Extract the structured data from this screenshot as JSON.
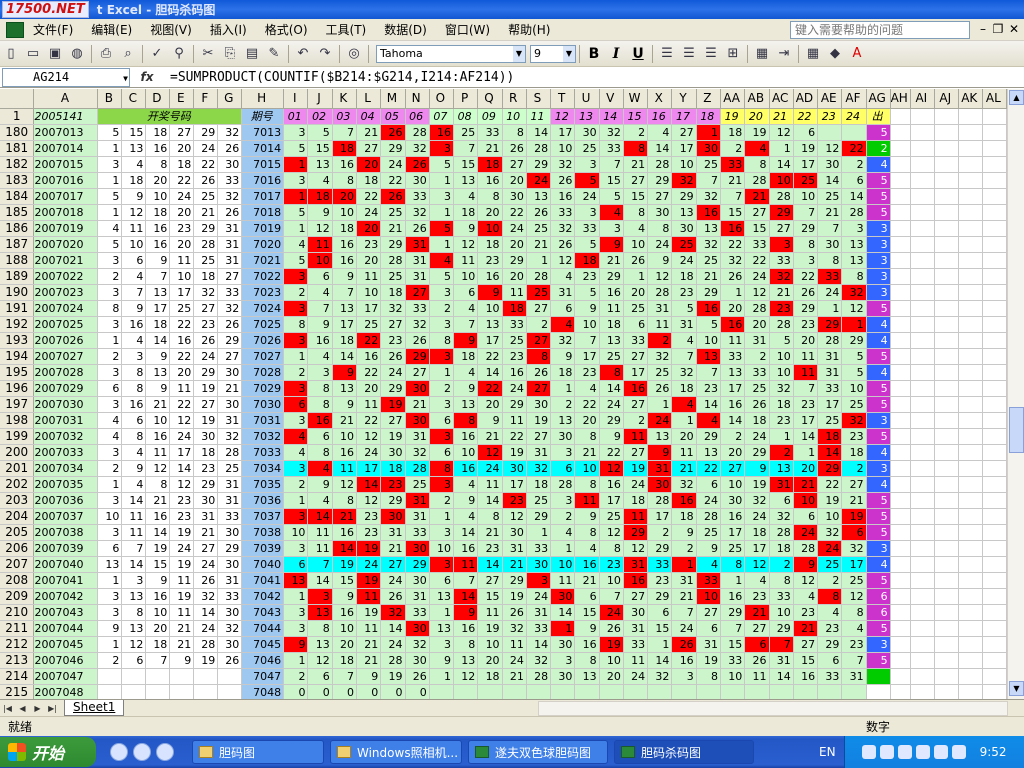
{
  "window": {
    "logo": "17500.NET",
    "title": "t Excel - 胆码杀码图"
  },
  "menu": {
    "items": [
      "文件(F)",
      "编辑(E)",
      "视图(V)",
      "插入(I)",
      "格式(O)",
      "工具(T)",
      "数据(D)",
      "窗口(W)",
      "帮助(H)"
    ],
    "help_placeholder": "键入需要帮助的问题"
  },
  "toolbar": {
    "font_name": "Tahoma",
    "font_size": "9",
    "bold": "B",
    "italic": "I",
    "underline": "U"
  },
  "formula_bar": {
    "name_box": "AG214",
    "fx": "fx",
    "formula": "=SUMPRODUCT(COUNTIF($B214:$G214,I214:AF214))"
  },
  "columns": [
    "A",
    "B",
    "C",
    "D",
    "E",
    "F",
    "G",
    "H",
    "I",
    "J",
    "K",
    "L",
    "M",
    "N",
    "O",
    "P",
    "Q",
    "R",
    "S",
    "T",
    "U",
    "V",
    "W",
    "X",
    "Y",
    "Z",
    "AA",
    "AB",
    "AC",
    "AD",
    "AE",
    "AF",
    "AG",
    "AH",
    "AI",
    "AJ",
    "AK",
    "AL"
  ],
  "row1": {
    "row_num": "1",
    "A": "2005141",
    "BG": "开奖号码",
    "H": "期号",
    "I_AF": [
      "01",
      "02",
      "03",
      "04",
      "05",
      "06",
      "07",
      "08",
      "09",
      "10",
      "11",
      "12",
      "13",
      "14",
      "15",
      "16",
      "17",
      "18",
      "19",
      "20",
      "21",
      "22",
      "23",
      "24"
    ],
    "AG": "出"
  },
  "rows": [
    {
      "r": "180",
      "a": "2007013",
      "w": [
        5,
        15,
        18,
        27,
        29,
        32
      ],
      "h": "7013",
      "m": [
        3,
        5,
        7,
        21,
        26,
        28,
        16,
        25,
        33,
        8,
        14,
        17,
        30,
        32,
        2,
        4,
        27,
        1,
        18,
        19,
        12,
        6
      ],
      "ag": "5"
    },
    {
      "r": "181",
      "a": "2007014",
      "w": [
        1,
        13,
        16,
        20,
        24,
        26
      ],
      "h": "7014",
      "m": [
        5,
        15,
        18,
        27,
        29,
        32,
        3,
        7,
        21,
        26,
        28,
        10,
        25,
        33,
        8,
        14,
        17,
        30,
        2,
        4,
        1,
        19,
        12,
        22
      ],
      "ag": "2"
    },
    {
      "r": "182",
      "a": "2007015",
      "w": [
        3,
        4,
        8,
        18,
        22,
        30
      ],
      "h": "7015",
      "m": [
        1,
        13,
        16,
        20,
        24,
        26,
        5,
        15,
        18,
        27,
        29,
        32,
        3,
        7,
        21,
        28,
        10,
        25,
        33,
        8,
        14,
        17,
        30,
        2
      ],
      "ag": "4"
    },
    {
      "r": "183",
      "a": "2007016",
      "w": [
        1,
        18,
        20,
        22,
        26,
        33
      ],
      "h": "7016",
      "m": [
        3,
        4,
        8,
        18,
        22,
        30,
        1,
        13,
        16,
        20,
        24,
        26,
        5,
        15,
        27,
        29,
        32,
        7,
        21,
        28,
        10,
        25,
        14,
        6
      ],
      "ag": "5"
    },
    {
      "r": "184",
      "a": "2007017",
      "w": [
        5,
        9,
        10,
        24,
        25,
        32
      ],
      "h": "7017",
      "m": [
        1,
        18,
        20,
        22,
        26,
        33,
        3,
        4,
        8,
        30,
        13,
        16,
        24,
        5,
        15,
        27,
        29,
        32,
        7,
        21,
        28,
        10,
        25,
        14
      ],
      "ag": "5"
    },
    {
      "r": "185",
      "a": "2007018",
      "w": [
        1,
        12,
        18,
        20,
        21,
        26
      ],
      "h": "7018",
      "m": [
        5,
        9,
        10,
        24,
        25,
        32,
        1,
        18,
        20,
        22,
        26,
        33,
        3,
        4,
        8,
        30,
        13,
        16,
        15,
        27,
        29,
        7,
        21,
        28
      ],
      "ag": "5"
    },
    {
      "r": "186",
      "a": "2007019",
      "w": [
        4,
        11,
        16,
        23,
        29,
        31
      ],
      "h": "7019",
      "m": [
        1,
        12,
        18,
        20,
        21,
        26,
        5,
        9,
        10,
        24,
        25,
        32,
        33,
        3,
        4,
        8,
        30,
        13,
        16,
        15,
        27,
        29,
        7,
        3
      ],
      "ag": "3"
    },
    {
      "r": "187",
      "a": "2007020",
      "w": [
        5,
        10,
        16,
        20,
        28,
        31
      ],
      "h": "7020",
      "m": [
        4,
        11,
        16,
        23,
        29,
        31,
        1,
        12,
        18,
        20,
        21,
        26,
        5,
        9,
        10,
        24,
        25,
        32,
        22,
        33,
        3,
        8,
        30,
        13
      ],
      "ag": "3"
    },
    {
      "r": "188",
      "a": "2007021",
      "w": [
        3,
        6,
        9,
        11,
        25,
        31
      ],
      "h": "7021",
      "m": [
        5,
        10,
        16,
        20,
        28,
        31,
        4,
        11,
        23,
        29,
        1,
        12,
        18,
        21,
        26,
        9,
        24,
        25,
        32,
        22,
        33,
        3,
        8,
        13
      ],
      "ag": "3"
    },
    {
      "r": "189",
      "a": "2007022",
      "w": [
        2,
        4,
        7,
        10,
        18,
        27
      ],
      "h": "7022",
      "m": [
        3,
        6,
        9,
        11,
        25,
        31,
        5,
        10,
        16,
        20,
        28,
        4,
        23,
        29,
        1,
        12,
        18,
        21,
        26,
        24,
        32,
        22,
        33,
        8
      ],
      "ag": "3"
    },
    {
      "r": "190",
      "a": "2007023",
      "w": [
        3,
        7,
        13,
        17,
        32,
        33
      ],
      "h": "7023",
      "m": [
        2,
        4,
        7,
        10,
        18,
        27,
        3,
        6,
        9,
        11,
        25,
        31,
        5,
        16,
        20,
        28,
        23,
        29,
        1,
        12,
        21,
        26,
        24,
        32
      ],
      "ag": "3"
    },
    {
      "r": "191",
      "a": "2007024",
      "w": [
        8,
        9,
        17,
        25,
        27,
        32
      ],
      "h": "7024",
      "m": [
        3,
        7,
        13,
        17,
        32,
        33,
        2,
        4,
        10,
        18,
        27,
        6,
        9,
        11,
        25,
        31,
        5,
        16,
        20,
        28,
        23,
        29,
        1,
        12
      ],
      "ag": "5"
    },
    {
      "r": "192",
      "a": "2007025",
      "w": [
        3,
        16,
        18,
        22,
        23,
        26
      ],
      "h": "7025",
      "m": [
        8,
        9,
        17,
        25,
        27,
        32,
        3,
        7,
        13,
        33,
        2,
        4,
        10,
        18,
        6,
        11,
        31,
        5,
        16,
        20,
        28,
        23,
        29,
        1
      ],
      "ag": "4"
    },
    {
      "r": "193",
      "a": "2007026",
      "w": [
        1,
        4,
        14,
        16,
        26,
        29
      ],
      "h": "7026",
      "m": [
        3,
        16,
        18,
        22,
        23,
        26,
        8,
        9,
        17,
        25,
        27,
        32,
        7,
        13,
        33,
        2,
        4,
        10,
        11,
        31,
        5,
        20,
        28,
        29
      ],
      "ag": "4"
    },
    {
      "r": "194",
      "a": "2007027",
      "w": [
        2,
        3,
        9,
        22,
        24,
        27
      ],
      "h": "7027",
      "m": [
        1,
        4,
        14,
        16,
        26,
        29,
        3,
        18,
        22,
        23,
        8,
        9,
        17,
        25,
        27,
        32,
        7,
        13,
        33,
        2,
        10,
        11,
        31,
        5
      ],
      "ag": "5"
    },
    {
      "r": "195",
      "a": "2007028",
      "w": [
        3,
        8,
        13,
        20,
        29,
        30
      ],
      "h": "7028",
      "m": [
        2,
        3,
        9,
        22,
        24,
        27,
        1,
        4,
        14,
        16,
        26,
        18,
        23,
        8,
        17,
        25,
        32,
        7,
        13,
        33,
        10,
        11,
        31,
        5
      ],
      "ag": "4"
    },
    {
      "r": "196",
      "a": "2007029",
      "w": [
        6,
        8,
        9,
        11,
        19,
        21
      ],
      "h": "7029",
      "m": [
        3,
        8,
        13,
        20,
        29,
        30,
        2,
        9,
        22,
        24,
        27,
        1,
        4,
        14,
        16,
        26,
        18,
        23,
        17,
        25,
        32,
        7,
        33,
        10
      ],
      "ag": "5"
    },
    {
      "r": "197",
      "a": "2007030",
      "w": [
        3,
        16,
        21,
        22,
        27,
        30
      ],
      "h": "7030",
      "m": [
        6,
        8,
        9,
        11,
        19,
        21,
        3,
        13,
        20,
        29,
        30,
        2,
        22,
        24,
        27,
        1,
        4,
        14,
        16,
        26,
        18,
        23,
        17,
        25
      ],
      "ag": "5"
    },
    {
      "r": "198",
      "a": "2007031",
      "w": [
        4,
        6,
        10,
        12,
        19,
        31
      ],
      "h": "7031",
      "m": [
        3,
        16,
        21,
        22,
        27,
        30,
        6,
        8,
        9,
        11,
        19,
        13,
        20,
        29,
        2,
        24,
        1,
        4,
        14,
        18,
        23,
        17,
        25,
        32
      ],
      "ag": "3"
    },
    {
      "r": "199",
      "a": "2007032",
      "w": [
        4,
        8,
        16,
        24,
        30,
        32
      ],
      "h": "7032",
      "m": [
        4,
        6,
        10,
        12,
        19,
        31,
        3,
        16,
        21,
        22,
        27,
        30,
        8,
        9,
        11,
        13,
        20,
        29,
        2,
        24,
        1,
        14,
        18,
        23
      ],
      "ag": "5"
    },
    {
      "r": "200",
      "a": "2007033",
      "w": [
        3,
        4,
        11,
        17,
        18,
        28
      ],
      "h": "7033",
      "m": [
        4,
        8,
        16,
        24,
        30,
        32,
        6,
        10,
        12,
        19,
        31,
        3,
        21,
        22,
        27,
        9,
        11,
        13,
        20,
        29,
        2,
        1,
        14,
        18
      ],
      "ag": "4"
    },
    {
      "r": "201",
      "a": "2007034",
      "w": [
        2,
        9,
        12,
        14,
        23,
        25
      ],
      "h": "7034",
      "m": [
        3,
        4,
        11,
        17,
        18,
        28,
        8,
        16,
        24,
        30,
        32,
        6,
        10,
        12,
        19,
        31,
        21,
        22,
        27,
        9,
        13,
        20,
        29,
        2
      ],
      "ag": "3"
    },
    {
      "r": "202",
      "a": "2007035",
      "w": [
        1,
        4,
        8,
        12,
        29,
        31
      ],
      "h": "7035",
      "m": [
        2,
        9,
        12,
        14,
        23,
        25,
        3,
        4,
        11,
        17,
        18,
        28,
        8,
        16,
        24,
        30,
        32,
        6,
        10,
        19,
        31,
        21,
        22,
        27
      ],
      "ag": "4"
    },
    {
      "r": "203",
      "a": "2007036",
      "w": [
        3,
        14,
        21,
        23,
        30,
        31
      ],
      "h": "7036",
      "m": [
        1,
        4,
        8,
        12,
        29,
        31,
        2,
        9,
        14,
        23,
        25,
        3,
        11,
        17,
        18,
        28,
        16,
        24,
        30,
        32,
        6,
        10,
        19,
        21
      ],
      "ag": "5"
    },
    {
      "r": "204",
      "a": "2007037",
      "w": [
        10,
        11,
        16,
        23,
        31,
        33
      ],
      "h": "7037",
      "m": [
        3,
        14,
        21,
        23,
        30,
        31,
        1,
        4,
        8,
        12,
        29,
        2,
        9,
        25,
        11,
        17,
        18,
        28,
        16,
        24,
        32,
        6,
        10,
        19
      ],
      "ag": "5"
    },
    {
      "r": "205",
      "a": "2007038",
      "w": [
        3,
        11,
        14,
        19,
        21,
        30
      ],
      "h": "7038",
      "m": [
        10,
        11,
        16,
        23,
        31,
        33,
        3,
        14,
        21,
        30,
        1,
        4,
        8,
        12,
        29,
        2,
        9,
        25,
        17,
        18,
        28,
        24,
        32,
        6
      ],
      "ag": "5"
    },
    {
      "r": "206",
      "a": "2007039",
      "w": [
        6,
        7,
        19,
        24,
        27,
        29
      ],
      "h": "7039",
      "m": [
        3,
        11,
        14,
        19,
        21,
        30,
        10,
        16,
        23,
        31,
        33,
        1,
        4,
        8,
        12,
        29,
        2,
        9,
        25,
        17,
        18,
        28,
        24,
        32
      ],
      "ag": "3"
    },
    {
      "r": "207",
      "a": "2007040",
      "w": [
        13,
        14,
        15,
        19,
        24,
        30
      ],
      "h": "7040",
      "m": [
        6,
        7,
        19,
        24,
        27,
        29,
        3,
        11,
        14,
        21,
        30,
        10,
        16,
        23,
        31,
        33,
        1,
        4,
        8,
        12,
        2,
        9,
        25,
        17
      ],
      "ag": "4"
    },
    {
      "r": "208",
      "a": "2007041",
      "w": [
        1,
        3,
        9,
        11,
        26,
        31
      ],
      "h": "7041",
      "m": [
        13,
        14,
        15,
        19,
        24,
        30,
        6,
        7,
        27,
        29,
        3,
        11,
        21,
        10,
        16,
        23,
        31,
        33,
        1,
        4,
        8,
        12,
        2,
        25
      ],
      "ag": "5"
    },
    {
      "r": "209",
      "a": "2007042",
      "w": [
        3,
        13,
        16,
        19,
        32,
        33
      ],
      "h": "7042",
      "m": [
        1,
        3,
        9,
        11,
        26,
        31,
        13,
        14,
        15,
        19,
        24,
        30,
        6,
        7,
        27,
        29,
        21,
        10,
        16,
        23,
        33,
        4,
        8,
        12
      ],
      "ag": "6"
    },
    {
      "r": "210",
      "a": "2007043",
      "w": [
        3,
        8,
        10,
        11,
        14,
        30
      ],
      "h": "7043",
      "m": [
        3,
        13,
        16,
        19,
        32,
        33,
        1,
        9,
        11,
        26,
        31,
        14,
        15,
        24,
        30,
        6,
        7,
        27,
        29,
        21,
        10,
        23,
        4,
        8
      ],
      "ag": "6"
    },
    {
      "r": "211",
      "a": "2007044",
      "w": [
        9,
        13,
        20,
        21,
        24,
        32
      ],
      "h": "7044",
      "m": [
        3,
        8,
        10,
        11,
        14,
        30,
        13,
        16,
        19,
        32,
        33,
        1,
        9,
        26,
        31,
        15,
        24,
        6,
        7,
        27,
        29,
        21,
        23,
        4
      ],
      "ag": "5"
    },
    {
      "r": "212",
      "a": "2007045",
      "w": [
        1,
        12,
        18,
        21,
        28,
        30
      ],
      "h": "7045",
      "m": [
        9,
        13,
        20,
        21,
        24,
        32,
        3,
        8,
        10,
        11,
        14,
        30,
        16,
        19,
        33,
        1,
        26,
        31,
        15,
        6,
        7,
        27,
        29,
        23
      ],
      "ag": "3"
    },
    {
      "r": "213",
      "a": "2007046",
      "w": [
        2,
        6,
        7,
        9,
        19,
        26
      ],
      "h": "7046",
      "m": [
        1,
        12,
        18,
        21,
        28,
        30,
        9,
        13,
        20,
        24,
        32,
        3,
        8,
        10,
        11,
        14,
        16,
        19,
        33,
        26,
        31,
        15,
        6,
        7
      ],
      "ag": "5"
    },
    {
      "r": "214",
      "a": "2007047",
      "w": [],
      "h": "7047",
      "m": [
        2,
        6,
        7,
        9,
        19,
        26,
        1,
        12,
        18,
        21,
        28,
        30,
        13,
        20,
        24,
        32,
        3,
        8,
        10,
        11,
        14,
        16,
        33,
        31
      ],
      "ag": ""
    },
    {
      "r": "215",
      "a": "2007048",
      "w": [],
      "h": "7048",
      "m": [
        0,
        0,
        0,
        0,
        0,
        0
      ],
      "ag": ""
    }
  ],
  "sheet": {
    "tab": "Sheet1"
  },
  "status": {
    "left": "就绪",
    "right": "数字"
  },
  "taskbar": {
    "start": "开始",
    "tasks": [
      "胆码图",
      "Windows照相机...",
      "遂夫双色球胆码图",
      "胆码杀码图"
    ],
    "lang": "EN",
    "clock": "9:52"
  },
  "colors": {
    "header_green": "#8cd64a",
    "header_blue": "#9ec8f0",
    "miss_green": "#ccf5cc",
    "hit_red": "#ff0000",
    "highlight_cyan": "#00ffff",
    "ag_blue": "#3366ff",
    "ag_purple": "#cc33cc",
    "ag_green": "#00cc00"
  }
}
